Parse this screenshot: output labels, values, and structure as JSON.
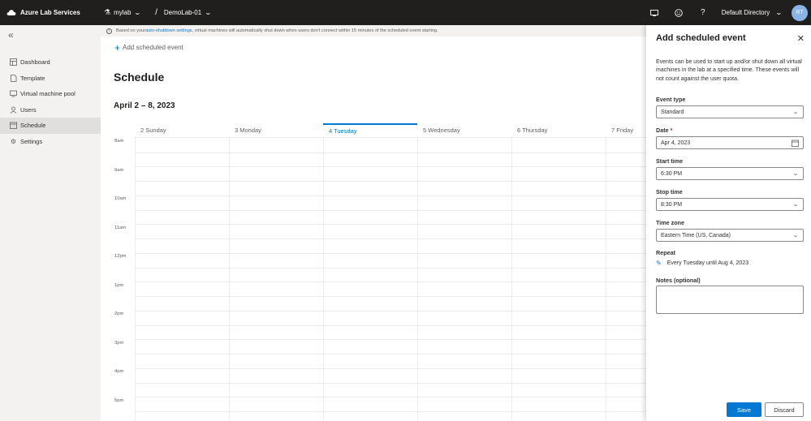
{
  "topbar": {
    "app_name": "Azure Lab Services",
    "plan": "mylab",
    "lab": "DemoLab-01",
    "directory": "Default Directory",
    "avatar_initials": "RT"
  },
  "sidebar": {
    "items": [
      {
        "label": "Dashboard",
        "icon": "dashboard-icon"
      },
      {
        "label": "Template",
        "icon": "template-icon"
      },
      {
        "label": "Virtual machine pool",
        "icon": "monitor-icon"
      },
      {
        "label": "Users",
        "icon": "users-icon"
      },
      {
        "label": "Schedule",
        "icon": "calendar-icon",
        "active": true
      },
      {
        "label": "Settings",
        "icon": "gear-icon"
      }
    ]
  },
  "info": {
    "prefix": "Based on your ",
    "link": "auto-shutdown settings",
    "suffix": ", virtual machines will automatically shut down when users don't connect within 15 minutes of the scheduled event starting."
  },
  "main": {
    "add_label": "Add scheduled event",
    "title": "Schedule",
    "week_range": "April 2 – 8, 2023",
    "days": [
      "2 Sunday",
      "3 Monday",
      "4 Tuesday",
      "5 Wednesday",
      "6 Thursday",
      "7 Friday"
    ],
    "today_index": 2,
    "hours": [
      "8am",
      "9am",
      "10am",
      "11am",
      "12pm",
      "1pm",
      "2pm",
      "3pm",
      "4pm",
      "5pm"
    ]
  },
  "panel": {
    "title": "Add scheduled event",
    "description": "Events can be used to start up and/or shut down all virtual machines in the lab at a specified time. These events will not count against the user quota.",
    "event_type_label": "Event type",
    "event_type_value": "Standard",
    "date_label": "Date",
    "date_required": "*",
    "date_value": "Apr 4, 2023",
    "start_label": "Start time",
    "start_value": "6:30 PM",
    "stop_label": "Stop time",
    "stop_value": "8:30 PM",
    "tz_label": "Time zone",
    "tz_value": "Eastern Time (US, Canada)",
    "repeat_label": "Repeat",
    "repeat_value": "Every Tuesday until Aug 4, 2023",
    "notes_label": "Notes (optional)",
    "notes_value": "",
    "save_label": "Save",
    "discard_label": "Discard"
  },
  "colors": {
    "accent": "#0078d4",
    "topbar": "#201f1e",
    "sidebar": "#f3f2f1"
  }
}
